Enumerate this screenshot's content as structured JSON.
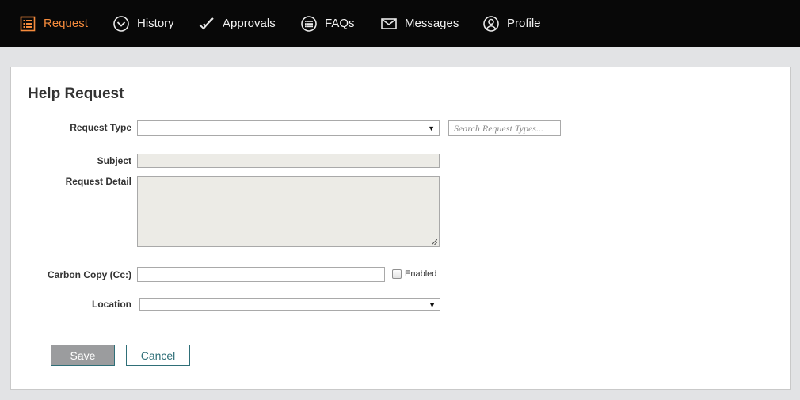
{
  "nav": {
    "items": [
      {
        "label": "Request",
        "icon": "list-icon",
        "active": true
      },
      {
        "label": "History",
        "icon": "chevron-circle-icon"
      },
      {
        "label": "Approvals",
        "icon": "double-check-icon"
      },
      {
        "label": "FAQs",
        "icon": "list-circle-icon"
      },
      {
        "label": "Messages",
        "icon": "envelope-icon"
      },
      {
        "label": "Profile",
        "icon": "user-circle-icon"
      }
    ],
    "active_color": "#f58b3c"
  },
  "form": {
    "title": "Help Request",
    "request_type": {
      "label": "Request Type",
      "value": "",
      "search_placeholder": "Search Request Types..."
    },
    "subject": {
      "label": "Subject",
      "value": ""
    },
    "request_detail": {
      "label": "Request Detail",
      "value": ""
    },
    "cc": {
      "label": "Carbon Copy (Cc:)",
      "value": "",
      "enabled_label": "Enabled",
      "enabled": false
    },
    "location": {
      "label": "Location",
      "value": ""
    },
    "save_label": "Save",
    "cancel_label": "Cancel"
  }
}
